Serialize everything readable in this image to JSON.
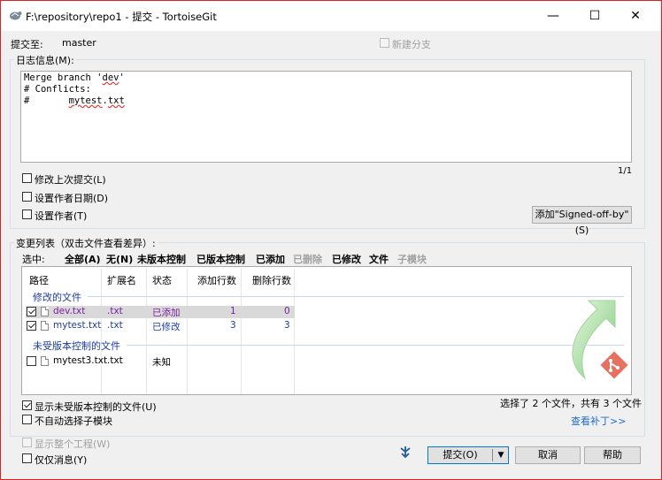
{
  "window": {
    "title": "F:\\repository\\repo1 - 提交 - TortoiseGit",
    "minimize": "—",
    "maximize": "☐",
    "close": "✕"
  },
  "commit_to": {
    "label": "提交至:",
    "branch": "master",
    "new_branch_label": "新建分支",
    "new_branch_checked": false
  },
  "log": {
    "group_title": "日志信息(M):",
    "message_lines": [
      "Merge branch 'dev'",
      "",
      "# Conflicts:",
      "#       mytest.txt"
    ],
    "counter": "1/1",
    "options": [
      {
        "label": "修改上次提交(L)",
        "checked": false
      },
      {
        "label": "设置作者日期(D)",
        "checked": false
      },
      {
        "label": "设置作者(T)",
        "checked": false
      }
    ],
    "signoff_button": "添加\"Signed-off-by\"(S)"
  },
  "changes": {
    "group_title": "变更列表（双击文件查看差异）:",
    "select_label": "选中:",
    "filters": [
      {
        "label": "全部(A)",
        "enabled": true
      },
      {
        "label": "无(N)",
        "enabled": true
      },
      {
        "label": "未版本控制",
        "enabled": true
      },
      {
        "label": "已版本控制",
        "enabled": true
      },
      {
        "label": "已添加",
        "enabled": true
      },
      {
        "label": "已删除",
        "enabled": false
      },
      {
        "label": "已修改",
        "enabled": true
      },
      {
        "label": "文件",
        "enabled": true
      },
      {
        "label": "子模块",
        "enabled": false
      }
    ],
    "columns": [
      "路径",
      "扩展名",
      "状态",
      "添加行数",
      "删除行数"
    ],
    "groups": [
      {
        "title": "修改的文件",
        "rows": [
          {
            "path": "dev.txt",
            "ext": ".txt",
            "status": "已添加",
            "added": "1",
            "deleted": "0",
            "checked": true,
            "selected": true
          },
          {
            "path": "mytest.txt",
            "ext": ".txt",
            "status": "已修改",
            "added": "3",
            "deleted": "3",
            "checked": true,
            "selected": false
          }
        ]
      },
      {
        "title": "未受版本控制的文件",
        "rows": [
          {
            "path": "mytest3.txt",
            "ext": ".txt",
            "status": "未知",
            "added": "",
            "deleted": "",
            "checked": false,
            "selected": false
          }
        ]
      }
    ],
    "show_unversioned": {
      "label": "显示未受版本控制的文件(U)",
      "checked": true
    },
    "no_autoselect_submodules": {
      "label": "不自动选择子模块",
      "checked": false
    },
    "summary": "选择了 2 个文件，共有 3 个文件",
    "view_patch": "查看补丁>>"
  },
  "bottom": {
    "show_whole_project": {
      "label": "显示整个工程(W)",
      "checked": false,
      "enabled": false
    },
    "message_only": {
      "label": "仅仅消息(Y)",
      "checked": false
    },
    "commit_button": "提交(O)",
    "cancel_button": "取消",
    "help_button": "帮助"
  },
  "colors": {
    "accent_link": "#1e6cc8",
    "status_added": "#7b1fa2",
    "status_modified": "#1e3c9c",
    "window_border": "#e02020"
  }
}
